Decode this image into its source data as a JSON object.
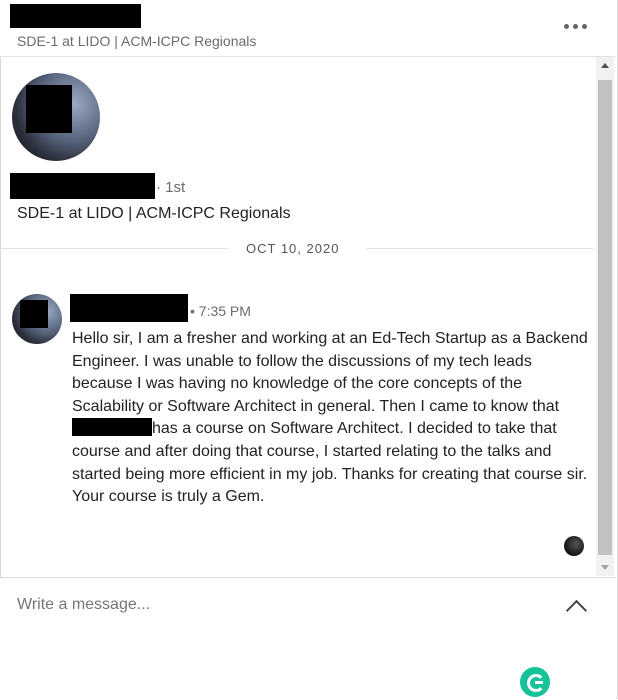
{
  "header": {
    "subtitle": "SDE-1 at LIDO | ACM-ICPC Regionals",
    "more_icon": "more-horizontal-icon"
  },
  "profile": {
    "connection_degree": "· 1st",
    "headline": "SDE-1 at LIDO | ACM-ICPC Regionals"
  },
  "conversation": {
    "date": "OCT 10, 2020",
    "message": {
      "time": "• 7:35 PM",
      "text_before_redaction": "Hello sir, I am a fresher and working at an Ed-Tech Startup as a Backend Engineer. I was unable to follow the discussions of my tech leads because I was having no knowledge of the core concepts of the Scalability or Software Architect in general. Then I came to know that",
      "text_after_redaction": "has a course on Software Architect. I decided to take that course and after doing that course, I started relating to the talks and started being more efficient in my job. Thanks for creating that course sir. Your course is truly a Gem."
    }
  },
  "compose": {
    "placeholder": "Write a message...",
    "expand_icon": "chevron-up-icon",
    "grammarly_icon": "grammarly-icon"
  },
  "colors": {
    "grammarly": "#15c39a",
    "redaction": "#000000"
  }
}
